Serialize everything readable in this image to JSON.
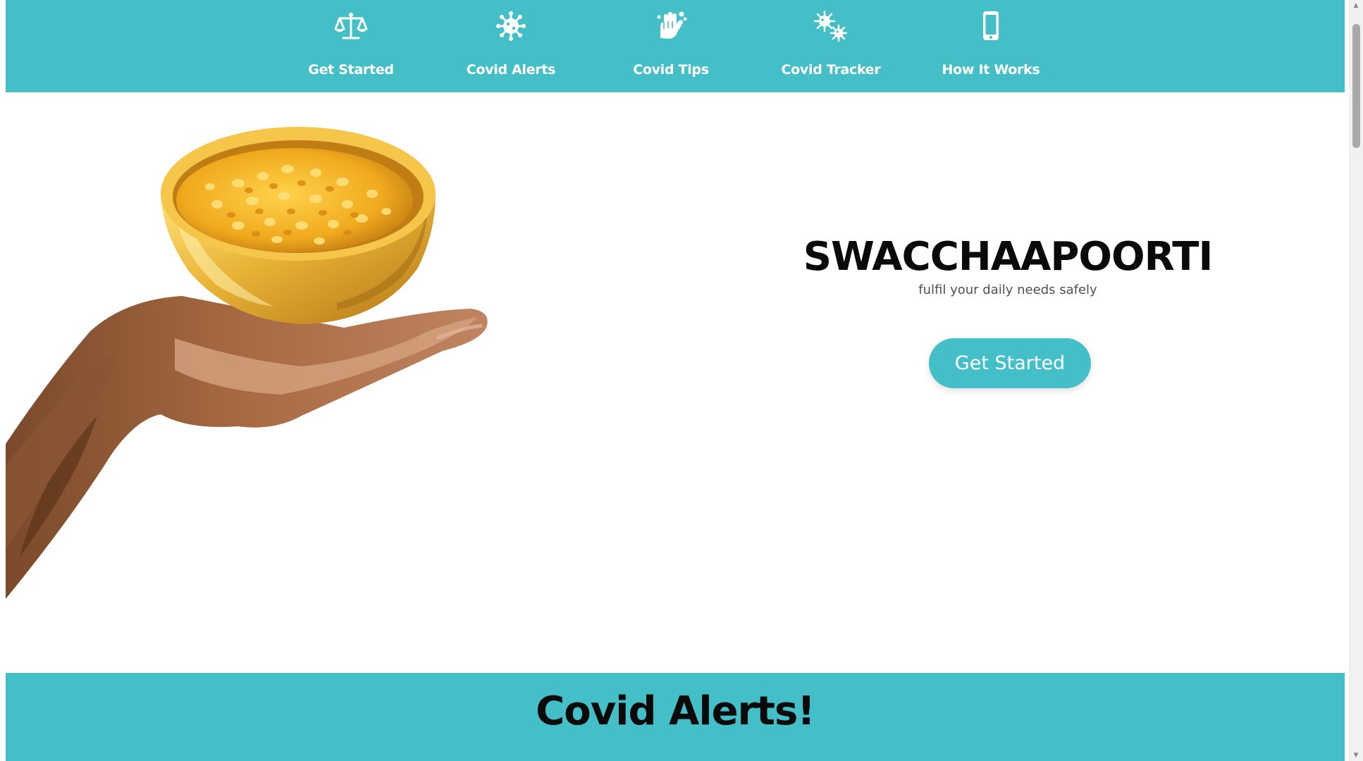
{
  "nav": {
    "items": [
      {
        "label": "Get Started",
        "icon": "scale-icon"
      },
      {
        "label": "Covid Alerts",
        "icon": "virus-icon"
      },
      {
        "label": "Covid Tips",
        "icon": "hand-wash-icon"
      },
      {
        "label": "Covid Tracker",
        "icon": "viruses-icon"
      },
      {
        "label": "How It Works",
        "icon": "mobile-phone-icon"
      }
    ]
  },
  "hero": {
    "title": "SWACCHAAPOORTI",
    "tagline": "fulfil your daily needs safely",
    "cta_label": "Get Started",
    "image": "hand-holding-bowl-of-lentils"
  },
  "alerts_section": {
    "heading": "Covid Alerts!"
  },
  "colors": {
    "accent": "#44bfc7",
    "text_dark": "#0a0a0a",
    "tagline": "#505050"
  }
}
